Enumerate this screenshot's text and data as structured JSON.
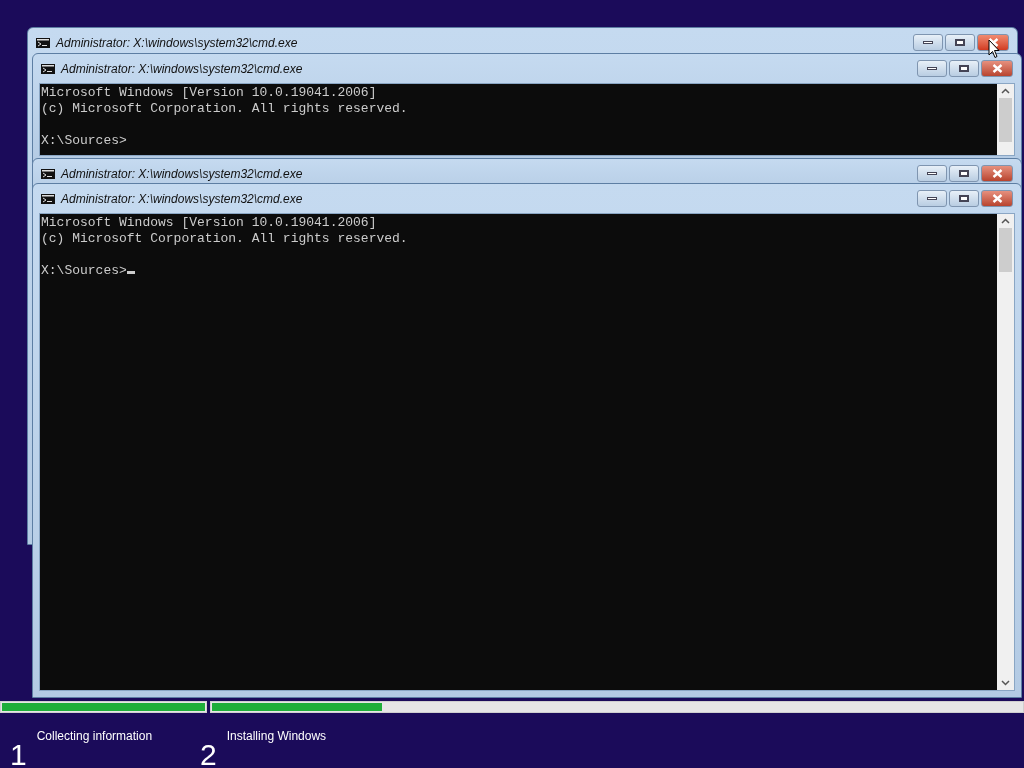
{
  "windows": [
    {
      "kind": "title-only",
      "title": "Administrator: X:\\windows\\system32\\cmd.exe",
      "close_hovered": true
    },
    {
      "kind": "console",
      "title": "Administrator: X:\\windows\\system32\\cmd.exe",
      "close_hovered": false,
      "lines": [
        "Microsoft Windows [Version 10.0.19041.2006]",
        "(c) Microsoft Corporation. All rights reserved."
      ],
      "prompt": "X:\\Sources>",
      "caret": false
    },
    {
      "kind": "title-only",
      "title": "Administrator: X:\\windows\\system32\\cmd.exe",
      "close_hovered": false
    },
    {
      "kind": "console",
      "title": "Administrator: X:\\windows\\system32\\cmd.exe",
      "close_hovered": false,
      "lines": [
        "Microsoft Windows [Version 10.0.19041.2006]",
        "(c) Microsoft Corporation. All rights reserved."
      ],
      "prompt": "X:\\Sources>",
      "caret": true
    }
  ],
  "steps": [
    {
      "number": "1",
      "label": "Collecting information",
      "level": 1
    },
    {
      "number": "2",
      "label": "Installing Windows",
      "level": 0.21
    }
  ]
}
